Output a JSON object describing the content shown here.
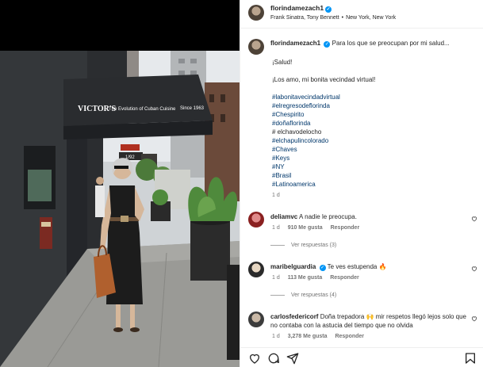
{
  "post": {
    "username": "florindamezach1",
    "audio": "Frank Sinatra, Tony Bennett",
    "location": "New York, New York"
  },
  "photo": {
    "awning_brand": "VICTOR'S",
    "awning_tagline": "The Evolution of Cuban Cuisine",
    "awning_since": "Since 1963",
    "street_number": "1/92"
  },
  "caption": {
    "username": "florindamezach1",
    "headline": "Para los que se preocupan por mi salud...",
    "line1": "¡Salud!",
    "line2": "¡Los amo, mi bonita vecindad virtual!",
    "hashtags": [
      "#labonitavecindadvirtual",
      "#elregresodeflorinda",
      "#Chespirito",
      "#doñaflorinda",
      "# elchavodelocho",
      "#elchapulincolorado",
      "#Chaves",
      "#Keys",
      "#NY",
      "#Brasil",
      "#Latinoamerica"
    ],
    "age": "1 d"
  },
  "comments": [
    {
      "username": "deliamvc",
      "text": "A nadie le preocupa.",
      "age": "1 d",
      "likes": "910 Me gusta",
      "reply": "Responder",
      "view_replies": "Ver respuestas (3)"
    },
    {
      "username": "maribelguardia",
      "text": "Te ves estupenda 🔥",
      "age": "1 d",
      "likes": "113 Me gusta",
      "reply": "Responder",
      "view_replies": "Ver respuestas (4)"
    },
    {
      "username": "carlosfedericorf",
      "text": "Doña trepadora 🙌 mir respetos llegó lejos solo que no contaba con la astucia del tiempo que no olvida",
      "age": "1 d",
      "likes": "3,278 Me gusta",
      "reply": "Responder"
    }
  ],
  "icons": {
    "like": "heart-icon",
    "comment": "comment-icon",
    "share": "share-icon",
    "save": "bookmark-icon"
  },
  "colors": {
    "link": "#00376b",
    "verified": "#0095f6",
    "muted": "#737373"
  }
}
